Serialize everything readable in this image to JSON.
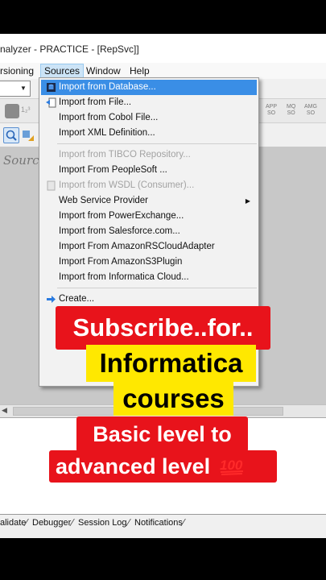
{
  "window": {
    "title": "nalyzer - PRACTICE - [RepSvc]]"
  },
  "menubar": [
    {
      "label": "rsioning"
    },
    {
      "label": "Sources"
    },
    {
      "label": "Window"
    },
    {
      "label": "Help"
    }
  ],
  "toolbar": {
    "mini_labels": [
      "APP\nSO",
      "MQ\nSO",
      "AMG\nSO"
    ]
  },
  "workspace": {
    "label": "Source"
  },
  "dropdown": {
    "items": [
      {
        "label": "Import from Database...",
        "state": "highlighted",
        "icon": "database-icon"
      },
      {
        "label": "Import from File...",
        "state": "normal",
        "icon": "file-import-icon"
      },
      {
        "label": "Import from Cobol File...",
        "state": "normal"
      },
      {
        "label": "Import XML Definition...",
        "state": "normal"
      },
      {
        "label": "Import from TIBCO Repository...",
        "state": "disabled"
      },
      {
        "label": "Import From PeopleSoft ...",
        "state": "normal"
      },
      {
        "label": "Import from WSDL (Consumer)...",
        "state": "disabled",
        "icon": "wsdl-icon"
      },
      {
        "label": "Web Service Provider",
        "state": "normal",
        "submenu": true
      },
      {
        "label": "Import from PowerExchange...",
        "state": "normal"
      },
      {
        "label": "Import from Salesforce.com...",
        "state": "normal"
      },
      {
        "label": "Import From AmazonRSCloudAdapter",
        "state": "normal"
      },
      {
        "label": "Import From AmazonS3Plugin",
        "state": "normal"
      },
      {
        "label": "Import from Informatica Cloud...",
        "state": "normal"
      },
      {
        "label": "Create...",
        "state": "normal",
        "icon": "create-arrow-icon"
      }
    ]
  },
  "tabs": [
    {
      "label": "alidate"
    },
    {
      "label": "Debugger"
    },
    {
      "label": "Session Log"
    },
    {
      "label": "Notifications"
    }
  ],
  "overlay": {
    "line1": "Subscribe..for..",
    "line2": "Informatica",
    "line3": "courses",
    "line4": "Basic level to",
    "line5": "advanced level",
    "emoji": "100-emoji-icon"
  },
  "colors": {
    "highlight": "#3a8ee6",
    "banner_red": "#e8131b",
    "banner_yellow": "#ffe800"
  }
}
